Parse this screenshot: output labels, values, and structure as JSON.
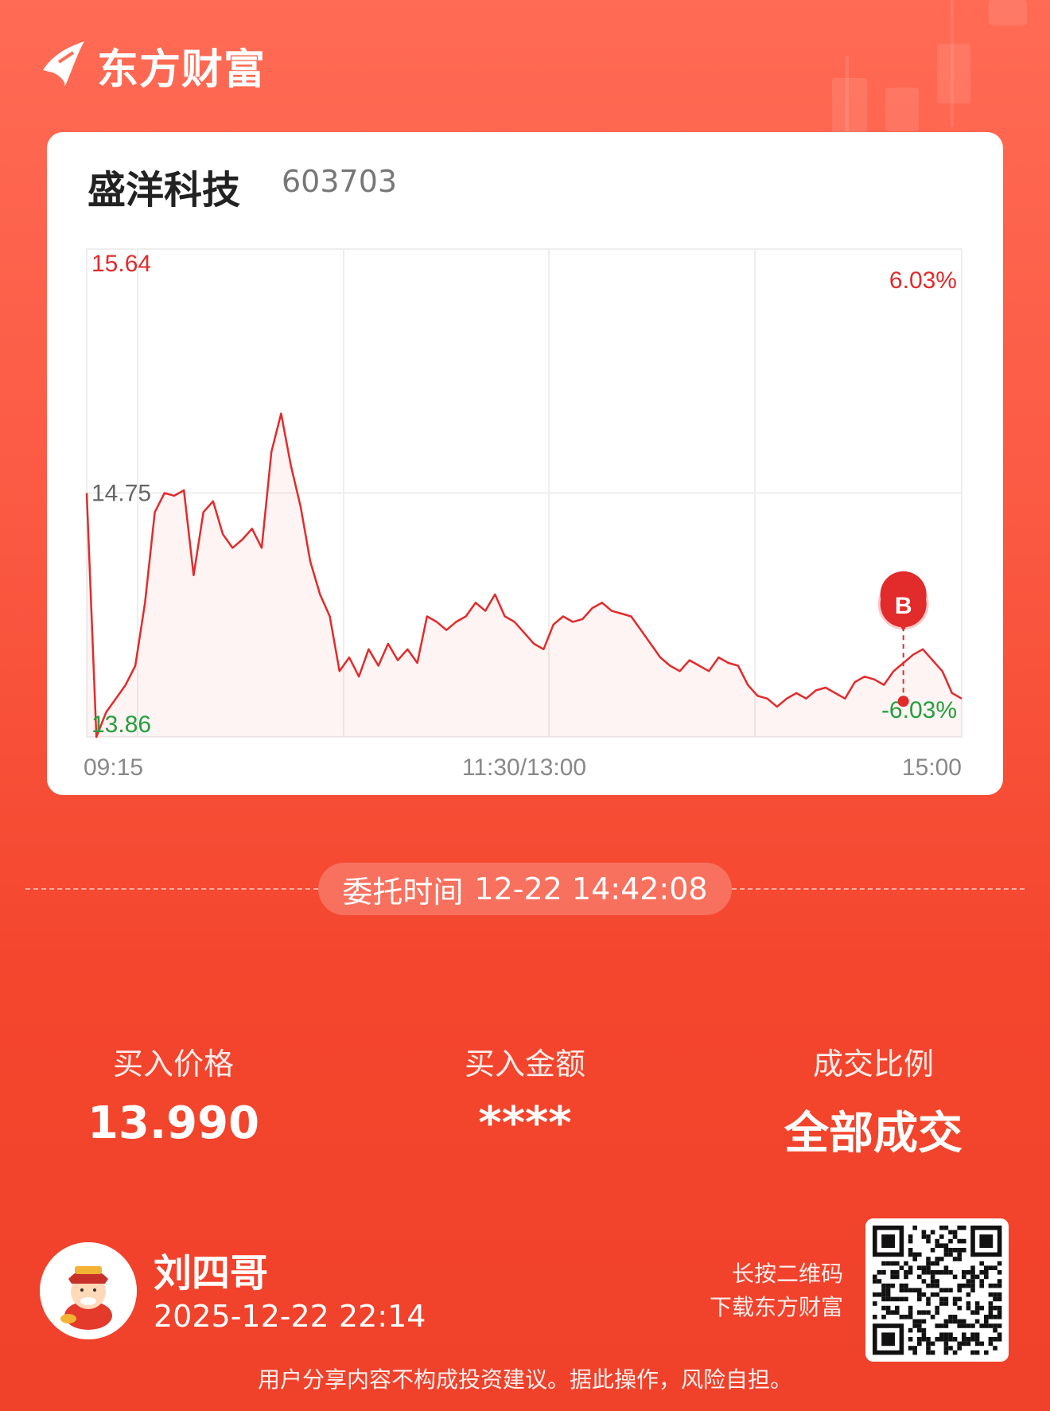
{
  "brand": {
    "name": "东方财富"
  },
  "stock": {
    "name": "盛洋科技",
    "code": "603703"
  },
  "chart_data": {
    "type": "line",
    "x_ticks": [
      "09:15",
      "11:30/13:00",
      "15:00"
    ],
    "y_labels": {
      "high": "15.64",
      "mid": "14.75",
      "low": "13.86"
    },
    "pct_labels": {
      "high": "6.03%",
      "low": "-6.03%"
    },
    "ylim": [
      13.86,
      15.64
    ],
    "series": [
      {
        "values": [
          14.75,
          13.86,
          13.95,
          14.0,
          14.05,
          14.12,
          14.35,
          14.68,
          14.75,
          14.74,
          14.76,
          14.45,
          14.68,
          14.72,
          14.6,
          14.55,
          14.58,
          14.62,
          14.55,
          14.9,
          15.04,
          14.85,
          14.7,
          14.5,
          14.38,
          14.3,
          14.1,
          14.15,
          14.08,
          14.18,
          14.12,
          14.2,
          14.14,
          14.18,
          14.13,
          14.3,
          14.28,
          14.25,
          14.28,
          14.3,
          14.35,
          14.32,
          14.38,
          14.3,
          14.28,
          14.24,
          14.2,
          14.18,
          14.27,
          14.3,
          14.28,
          14.29,
          14.33,
          14.35,
          14.32,
          14.31,
          14.3,
          14.25,
          14.2,
          14.15,
          14.12,
          14.1,
          14.14,
          14.12,
          14.1,
          14.15,
          14.13,
          14.12,
          14.05,
          14.01,
          14.0,
          13.97,
          14.0,
          14.02,
          14.0,
          14.03,
          14.04,
          14.02,
          14.0,
          14.06,
          14.08,
          14.07,
          14.05,
          14.1,
          14.13,
          14.16,
          14.18,
          14.14,
          14.1,
          14.02,
          14.0
        ]
      }
    ],
    "marker": {
      "label": "B",
      "price": 13.99,
      "time": "14:42"
    }
  },
  "order": {
    "label": "委托时间",
    "time": "12-22 14:42:08"
  },
  "stats": [
    {
      "label": "买入价格",
      "value": "13.990"
    },
    {
      "label": "买入金额",
      "value": "****"
    },
    {
      "label": "成交比例",
      "value": "全部成交"
    }
  ],
  "user": {
    "name": "刘四哥",
    "time": "2025-12-22 22:14"
  },
  "qr": {
    "hint_line1": "长按二维码",
    "hint_line2": "下载东方财富"
  },
  "disclaimer": "用户分享内容不构成投资建议。据此操作，风险自担。",
  "colors": {
    "up": "#e22b2b",
    "down": "#22a03b",
    "accent": "#f4452d"
  }
}
